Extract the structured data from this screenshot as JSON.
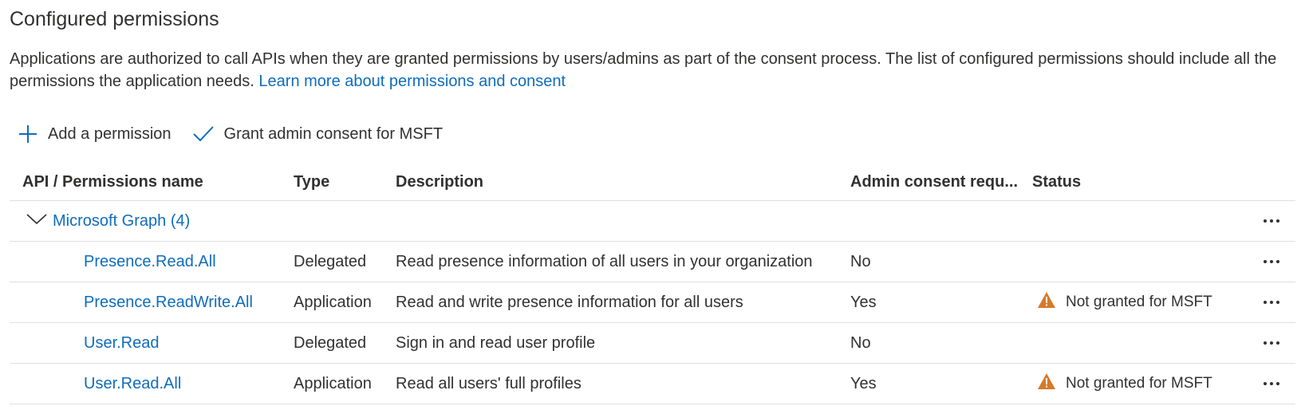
{
  "page": {
    "title": "Configured permissions",
    "intro_text": "Applications are authorized to call APIs when they are granted permissions by users/admins as part of the consent process. The list of configured permissions should include all the permissions the application needs.",
    "intro_link": "Learn more about permissions and consent"
  },
  "toolbar": {
    "add_label": "Add a permission",
    "grant_label": "Grant admin consent for MSFT"
  },
  "table": {
    "headers": [
      "API / Permissions name",
      "Type",
      "Description",
      "Admin consent requ...",
      "Status"
    ],
    "group": {
      "label": "Microsoft Graph (4)"
    },
    "rows": [
      {
        "name": "Presence.Read.All",
        "type": "Delegated",
        "description": "Read presence information of all users in your organization",
        "admin": "No",
        "status": ""
      },
      {
        "name": "Presence.ReadWrite.All",
        "type": "Application",
        "description": "Read and write presence information for all users",
        "admin": "Yes",
        "status": "Not granted for MSFT"
      },
      {
        "name": "User.Read",
        "type": "Delegated",
        "description": "Sign in and read user profile",
        "admin": "No",
        "status": ""
      },
      {
        "name": "User.Read.All",
        "type": "Application",
        "description": "Read all users' full profiles",
        "admin": "Yes",
        "status": "Not granted for MSFT"
      }
    ]
  },
  "colors": {
    "accent": "#0f6cbd",
    "warning": "#d47b2a",
    "border": "#e1dfdd"
  },
  "icons": {
    "add": "plus-icon",
    "grant": "check-icon",
    "expand": "chevron-down-icon",
    "warning": "warning-icon",
    "more": "more-icon"
  }
}
